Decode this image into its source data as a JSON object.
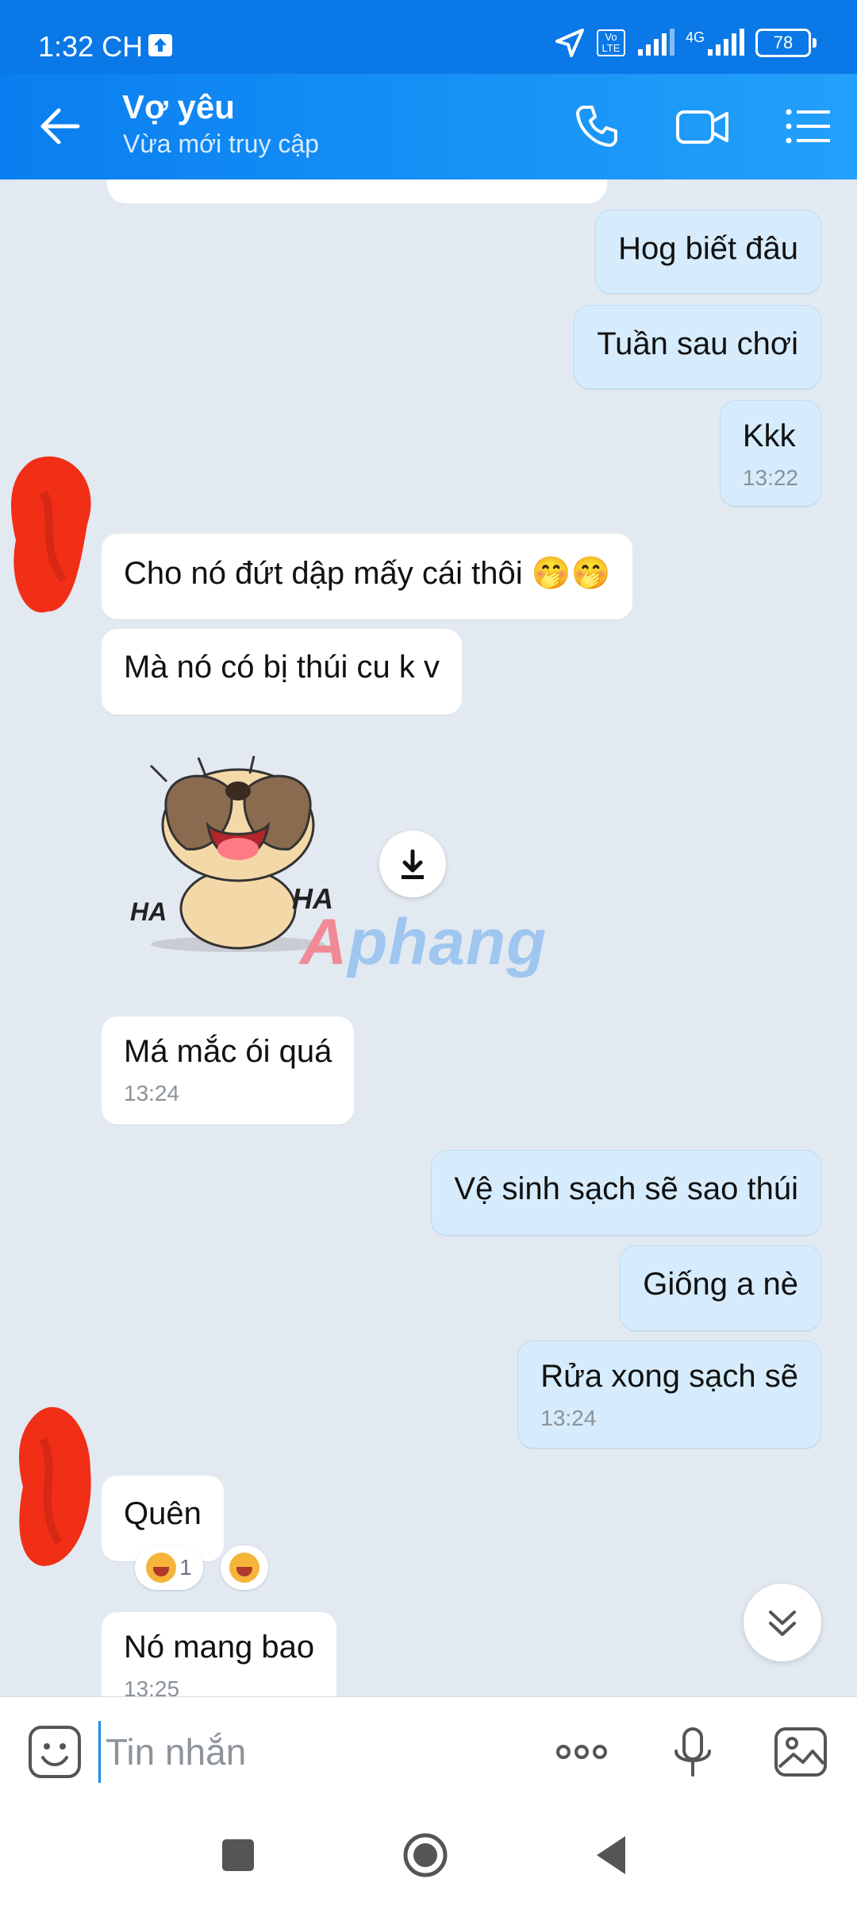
{
  "status_bar": {
    "time": "1:32 CH",
    "volte": "Vo LTE",
    "network": "4G",
    "battery": "78"
  },
  "header": {
    "contact_name": "Vợ yêu",
    "contact_status": "Vừa mới truy cập"
  },
  "messages": [
    {
      "dir": "out",
      "text": "Hog biết đâu"
    },
    {
      "dir": "out",
      "text": "Tuần sau chơi"
    },
    {
      "dir": "out",
      "text": "Kkk",
      "time": "13:22"
    },
    {
      "dir": "in",
      "text": "Cho nó đứt dập mấy cái thôi 🤭🤭"
    },
    {
      "dir": "in",
      "text": "Mà nó có bị thúi cu k v"
    },
    {
      "dir": "in",
      "text": "Má mắc ói quá",
      "time": "13:24"
    },
    {
      "dir": "out",
      "text": "Vệ sinh sạch sẽ sao thúi"
    },
    {
      "dir": "out",
      "text": "Giống a nè"
    },
    {
      "dir": "out",
      "text": "Rửa xong sạch sẽ",
      "time": "13:24"
    },
    {
      "dir": "in",
      "text": "Quên"
    },
    {
      "dir": "in",
      "text": "Nó mang bao",
      "time": "13:25"
    }
  ],
  "sticker": {
    "text_left": "HA",
    "text_right": "HA"
  },
  "watermark": {
    "part_a": "A",
    "part_b": "phang"
  },
  "reactions": {
    "count": "1"
  },
  "composer": {
    "placeholder": "Tin nhắn"
  },
  "colors": {
    "header": "#1590f5",
    "outgoing_bubble": "#d6ecfc",
    "incoming_bubble": "#ffffff",
    "chat_background": "#e2e9f1"
  },
  "icons": [
    "back-arrow-icon",
    "phone-icon",
    "video-call-icon",
    "menu-list-icon",
    "download-icon",
    "chevron-double-down-icon",
    "sticker-icon",
    "more-icon",
    "microphone-icon",
    "image-icon"
  ]
}
